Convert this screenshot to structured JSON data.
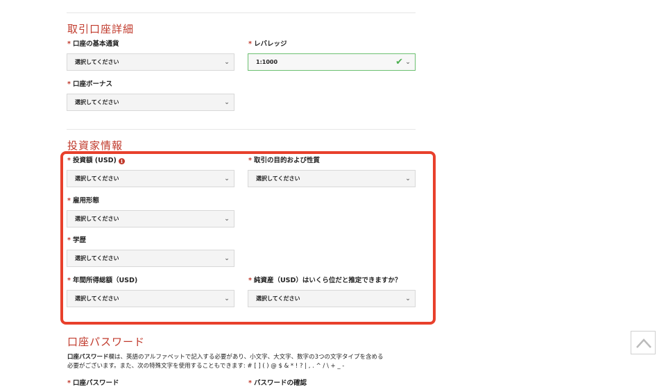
{
  "trading_account": {
    "title": "取引口座詳細",
    "required_mark": "*",
    "fields": {
      "base_currency": {
        "label": "口座の基本通貨",
        "value": "選択してください"
      },
      "leverage": {
        "label": "レバレッジ",
        "value": "1:1000"
      },
      "bonus": {
        "label": "口座ボーナス",
        "value": "選択してください"
      }
    }
  },
  "investor_info": {
    "title": "投資家情報",
    "fields": {
      "investment_amount": {
        "label": "投資額 (USD)",
        "value": "選択してください"
      },
      "trading_purpose": {
        "label": "取引の目的および性質",
        "value": "選択してください"
      },
      "employment": {
        "label": "雇用形態",
        "value": "選択してください"
      },
      "education": {
        "label": "学歴",
        "value": "選択してください"
      },
      "annual_income": {
        "label": "年間所得総額（USD)",
        "value": "選択してください"
      },
      "net_worth": {
        "label": "純資産（USD）はいくら位だと推定できますか？",
        "value": "選択してください"
      }
    }
  },
  "account_password": {
    "title": "口座パスワード",
    "desc_bold": "口座パスワード",
    "desc_line1": "欄は、英語のアルファベットで記入する必要があり、小文字、大文字、数字の3つの文字タイプを含める",
    "desc_line2": "必要がございます。また、次の特殊文字を使用することもできます: # [ ] ( ) @ $ & * ! ? | , . ^ / \\ + _ -",
    "password_label": "口座パスワード",
    "confirm_label": "パスワードの確認"
  },
  "icons": {
    "info": "info-icon",
    "chevron": "chevron-down-icon",
    "check": "check-icon",
    "scroll_top": "chevron-up-icon"
  },
  "colors": {
    "accent": "#c0392b",
    "highlight": "#e8402c",
    "valid": "#4caf50"
  }
}
